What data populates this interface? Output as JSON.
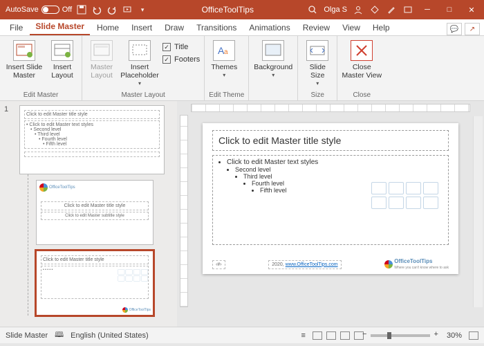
{
  "titlebar": {
    "autosave": "AutoSave",
    "autosave_state": "Off",
    "doc_title": "OfficeToolTips",
    "user": "Olga S"
  },
  "tabs": [
    "File",
    "Slide Master",
    "Home",
    "Insert",
    "Draw",
    "Transitions",
    "Animations",
    "Review",
    "View",
    "Help"
  ],
  "active_tab": "Slide Master",
  "ribbon": {
    "edit_master": {
      "insert_slide_master": "Insert Slide Master",
      "insert_layout": "Insert Layout",
      "group_label": "Edit Master"
    },
    "master_layout": {
      "master_layout": "Master Layout",
      "insert_placeholder": "Insert Placeholder",
      "chk_title": "Title",
      "chk_footers": "Footers",
      "group_label": "Master Layout"
    },
    "edit_theme": {
      "themes": "Themes",
      "group_label": "Edit Theme"
    },
    "background": {
      "background": "Background",
      "group_label": ""
    },
    "size": {
      "slide_size": "Slide Size",
      "group_label": "Size"
    },
    "close": {
      "close_master": "Close Master View",
      "group_label": "Close"
    }
  },
  "thumbs": {
    "number": "1",
    "master_title": "Click to edit Master title style",
    "master_body": "Click to edit Master text styles",
    "l2": "Second level",
    "l3": "Third level",
    "l4": "Fourth level",
    "l5": "Fifth level",
    "layout1_title": "Click to edit Master title style",
    "layout1_sub": "Click to edit Master subtitle style",
    "layout2_title": "Click to edit Master title style",
    "brand": "OfficeToolTips"
  },
  "canvas": {
    "title": "Click to edit Master title style",
    "b1": "Click to edit Master text styles",
    "b2": "Second level",
    "b3": "Third level",
    "b4": "Fourth level",
    "b5": "Fifth level",
    "footer_page": "‹#›",
    "footer_year": "2020,",
    "footer_link": "www.OfficeToolTips.com",
    "brand": "OfficeToolTips",
    "tagline": "Where you can't know where to ask"
  },
  "status": {
    "mode": "Slide Master",
    "lang": "English (United States)",
    "zoom": "30%"
  }
}
